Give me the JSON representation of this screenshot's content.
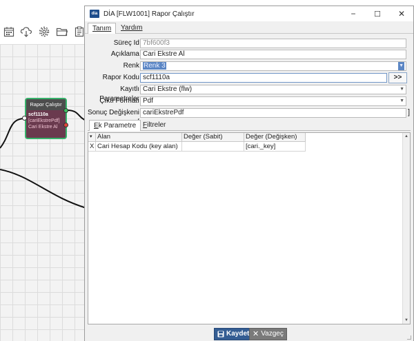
{
  "dialog": {
    "title": "DİA [FLW1001] Rapor Çalıştır",
    "app_icon_text": "dia",
    "controls": {
      "minimize": "−",
      "maximize": "☐",
      "close": "✕"
    }
  },
  "menu": {
    "tabs": [
      {
        "label": "Tanım",
        "active": true
      },
      {
        "label": "Yardım",
        "active": false
      }
    ]
  },
  "form": {
    "surec_id": {
      "label": "Süreç Id",
      "value": "7bf600f3"
    },
    "aciklama": {
      "label": "Açıklama",
      "value": "Cari Ekstre Al"
    },
    "renk": {
      "label": "Renk",
      "value": "Renk 3"
    },
    "rapor_kodu": {
      "label": "Rapor Kodu",
      "value": "scf1110a",
      "button": ">>"
    },
    "kayitli_parametreler": {
      "label": "Kayıtlı Parametreler",
      "value": "Cari Ekstre (flw)"
    },
    "cikti_formati": {
      "label": "Çıktı Formatı",
      "value": "Pdf"
    },
    "sonuc_degiskeni": {
      "label": "Sonuç Değişkeni [",
      "value": "cariEkstrePdf",
      "suffix": "]"
    }
  },
  "subtabs": [
    {
      "label_u": "E",
      "label_rest": "k Parametre",
      "active": true
    },
    {
      "label_u": "F",
      "label_rest": "iltreler",
      "active": false
    }
  ],
  "grid": {
    "headers": {
      "sort": "▾",
      "alan": "Alan",
      "deger_sabit": "Değer (Sabit)",
      "deger_degisken": "Değer (Değişken)"
    },
    "rows": [
      {
        "marker": "X",
        "alan": "Cari Hesap Kodu (key alan)",
        "deger_sabit": "",
        "deger_degisken": "[cari._key]"
      }
    ]
  },
  "footer": {
    "save": "Kaydet",
    "cancel": "Vazgeç"
  },
  "node": {
    "header": "Rapor Çalıştır",
    "line1": "scf1110a",
    "line2": "[cariEkstrePdf]",
    "line3": "Cari Ekstre Al"
  },
  "colors": {
    "accent": "#345d93",
    "node_fill": "#6a3a4e",
    "node_border": "#37b26b",
    "selection": "#5b86c4"
  },
  "icons": [
    "calendar-icon",
    "cloud-download-icon",
    "gear-icon",
    "folder-icon",
    "clipboard-icon"
  ]
}
